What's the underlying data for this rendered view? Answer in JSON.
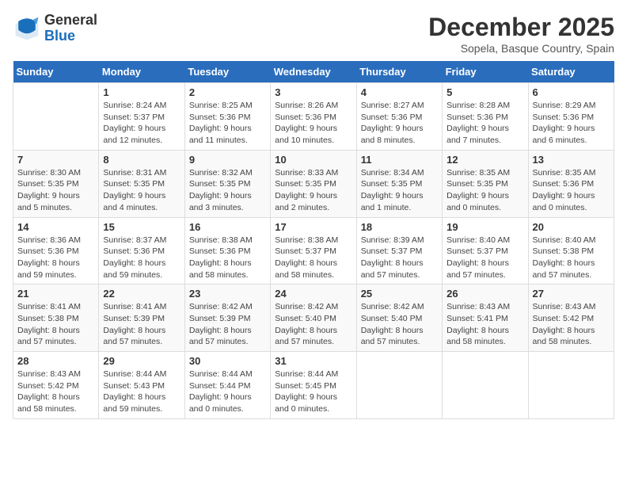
{
  "logo": {
    "line1": "General",
    "line2": "Blue"
  },
  "title": "December 2025",
  "location": "Sopela, Basque Country, Spain",
  "header": {
    "days": [
      "Sunday",
      "Monday",
      "Tuesday",
      "Wednesday",
      "Thursday",
      "Friday",
      "Saturday"
    ]
  },
  "weeks": [
    [
      {
        "day": "",
        "info": ""
      },
      {
        "day": "1",
        "info": "Sunrise: 8:24 AM\nSunset: 5:37 PM\nDaylight: 9 hours\nand 12 minutes."
      },
      {
        "day": "2",
        "info": "Sunrise: 8:25 AM\nSunset: 5:36 PM\nDaylight: 9 hours\nand 11 minutes."
      },
      {
        "day": "3",
        "info": "Sunrise: 8:26 AM\nSunset: 5:36 PM\nDaylight: 9 hours\nand 10 minutes."
      },
      {
        "day": "4",
        "info": "Sunrise: 8:27 AM\nSunset: 5:36 PM\nDaylight: 9 hours\nand 8 minutes."
      },
      {
        "day": "5",
        "info": "Sunrise: 8:28 AM\nSunset: 5:36 PM\nDaylight: 9 hours\nand 7 minutes."
      },
      {
        "day": "6",
        "info": "Sunrise: 8:29 AM\nSunset: 5:36 PM\nDaylight: 9 hours\nand 6 minutes."
      }
    ],
    [
      {
        "day": "7",
        "info": "Sunrise: 8:30 AM\nSunset: 5:35 PM\nDaylight: 9 hours\nand 5 minutes."
      },
      {
        "day": "8",
        "info": "Sunrise: 8:31 AM\nSunset: 5:35 PM\nDaylight: 9 hours\nand 4 minutes."
      },
      {
        "day": "9",
        "info": "Sunrise: 8:32 AM\nSunset: 5:35 PM\nDaylight: 9 hours\nand 3 minutes."
      },
      {
        "day": "10",
        "info": "Sunrise: 8:33 AM\nSunset: 5:35 PM\nDaylight: 9 hours\nand 2 minutes."
      },
      {
        "day": "11",
        "info": "Sunrise: 8:34 AM\nSunset: 5:35 PM\nDaylight: 9 hours\nand 1 minute."
      },
      {
        "day": "12",
        "info": "Sunrise: 8:35 AM\nSunset: 5:35 PM\nDaylight: 9 hours\nand 0 minutes."
      },
      {
        "day": "13",
        "info": "Sunrise: 8:35 AM\nSunset: 5:36 PM\nDaylight: 9 hours\nand 0 minutes."
      }
    ],
    [
      {
        "day": "14",
        "info": "Sunrise: 8:36 AM\nSunset: 5:36 PM\nDaylight: 8 hours\nand 59 minutes."
      },
      {
        "day": "15",
        "info": "Sunrise: 8:37 AM\nSunset: 5:36 PM\nDaylight: 8 hours\nand 59 minutes."
      },
      {
        "day": "16",
        "info": "Sunrise: 8:38 AM\nSunset: 5:36 PM\nDaylight: 8 hours\nand 58 minutes."
      },
      {
        "day": "17",
        "info": "Sunrise: 8:38 AM\nSunset: 5:37 PM\nDaylight: 8 hours\nand 58 minutes."
      },
      {
        "day": "18",
        "info": "Sunrise: 8:39 AM\nSunset: 5:37 PM\nDaylight: 8 hours\nand 57 minutes."
      },
      {
        "day": "19",
        "info": "Sunrise: 8:40 AM\nSunset: 5:37 PM\nDaylight: 8 hours\nand 57 minutes."
      },
      {
        "day": "20",
        "info": "Sunrise: 8:40 AM\nSunset: 5:38 PM\nDaylight: 8 hours\nand 57 minutes."
      }
    ],
    [
      {
        "day": "21",
        "info": "Sunrise: 8:41 AM\nSunset: 5:38 PM\nDaylight: 8 hours\nand 57 minutes."
      },
      {
        "day": "22",
        "info": "Sunrise: 8:41 AM\nSunset: 5:39 PM\nDaylight: 8 hours\nand 57 minutes."
      },
      {
        "day": "23",
        "info": "Sunrise: 8:42 AM\nSunset: 5:39 PM\nDaylight: 8 hours\nand 57 minutes."
      },
      {
        "day": "24",
        "info": "Sunrise: 8:42 AM\nSunset: 5:40 PM\nDaylight: 8 hours\nand 57 minutes."
      },
      {
        "day": "25",
        "info": "Sunrise: 8:42 AM\nSunset: 5:40 PM\nDaylight: 8 hours\nand 57 minutes."
      },
      {
        "day": "26",
        "info": "Sunrise: 8:43 AM\nSunset: 5:41 PM\nDaylight: 8 hours\nand 58 minutes."
      },
      {
        "day": "27",
        "info": "Sunrise: 8:43 AM\nSunset: 5:42 PM\nDaylight: 8 hours\nand 58 minutes."
      }
    ],
    [
      {
        "day": "28",
        "info": "Sunrise: 8:43 AM\nSunset: 5:42 PM\nDaylight: 8 hours\nand 58 minutes."
      },
      {
        "day": "29",
        "info": "Sunrise: 8:44 AM\nSunset: 5:43 PM\nDaylight: 8 hours\nand 59 minutes."
      },
      {
        "day": "30",
        "info": "Sunrise: 8:44 AM\nSunset: 5:44 PM\nDaylight: 9 hours\nand 0 minutes."
      },
      {
        "day": "31",
        "info": "Sunrise: 8:44 AM\nSunset: 5:45 PM\nDaylight: 9 hours\nand 0 minutes."
      },
      {
        "day": "",
        "info": ""
      },
      {
        "day": "",
        "info": ""
      },
      {
        "day": "",
        "info": ""
      }
    ]
  ]
}
